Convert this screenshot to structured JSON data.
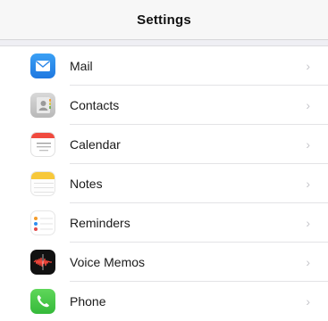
{
  "nav": {
    "title": "Settings"
  },
  "rows": [
    {
      "label": "Mail",
      "icon": "mail-icon"
    },
    {
      "label": "Contacts",
      "icon": "contacts-icon"
    },
    {
      "label": "Calendar",
      "icon": "calendar-icon"
    },
    {
      "label": "Notes",
      "icon": "notes-icon"
    },
    {
      "label": "Reminders",
      "icon": "reminders-icon"
    },
    {
      "label": "Voice Memos",
      "icon": "voice-memos-icon"
    },
    {
      "label": "Phone",
      "icon": "phone-icon"
    }
  ],
  "chevron": "›"
}
